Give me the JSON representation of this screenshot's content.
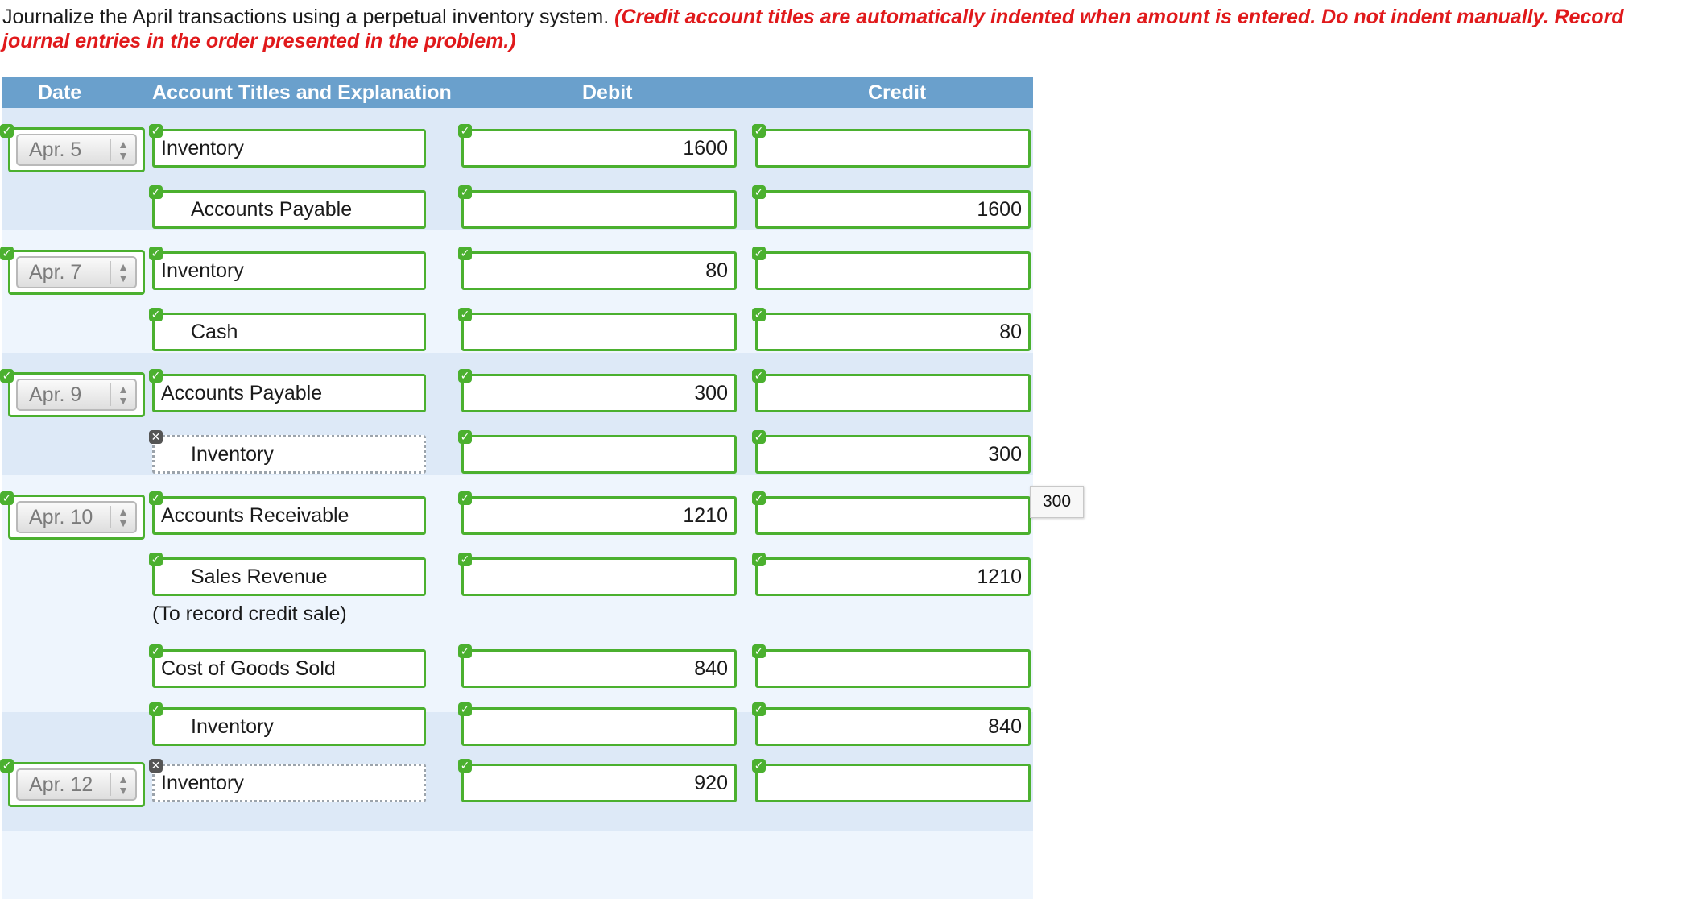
{
  "instructions": {
    "text": "Journalize the April transactions using a perpetual inventory system.",
    "note": "(Credit account titles are automatically indented when amount is entered. Do not indent manually. Record journal entries in the order presented in the problem.)"
  },
  "table": {
    "headers": {
      "date": "Date",
      "account": "Account Titles and Explanation",
      "debit": "Debit",
      "credit": "Credit"
    },
    "rows": [
      {
        "date": "Apr. 5",
        "account": "Inventory",
        "debit": "1600",
        "credit": "",
        "status": "correct"
      },
      {
        "date": "",
        "account": "Accounts Payable",
        "debit": "",
        "credit": "1600",
        "status": "correct"
      },
      {
        "date": "Apr. 7",
        "account": "Inventory",
        "debit": "80",
        "credit": "",
        "status": "correct"
      },
      {
        "date": "",
        "account": "Cash",
        "debit": "",
        "credit": "80",
        "status": "correct"
      },
      {
        "date": "Apr. 9",
        "account": "Accounts Payable",
        "debit": "300",
        "credit": "",
        "status": "correct"
      },
      {
        "date": "",
        "account": "Inventory",
        "debit": "",
        "credit": "300",
        "status": "incorrect"
      },
      {
        "date": "Apr. 10",
        "account": "Accounts Receivable",
        "debit": "1210",
        "credit": "",
        "status": "correct"
      },
      {
        "date": "",
        "account": "Sales Revenue",
        "debit": "",
        "credit": "1210",
        "status": "correct"
      },
      {
        "date": "",
        "account": "Cost of Goods Sold",
        "debit": "840",
        "credit": "",
        "status": "correct"
      },
      {
        "date": "",
        "account": "Inventory",
        "debit": "",
        "credit": "840",
        "status": "correct"
      },
      {
        "date": "Apr. 12",
        "account": "Inventory",
        "debit": "920",
        "credit": "",
        "status": "incorrect"
      }
    ],
    "explanation": "(To record credit sale)"
  },
  "tooltip": "300",
  "icons": {
    "correct": "check-icon",
    "incorrect": "x-icon",
    "select_arrows": "updown-arrows-icon"
  },
  "colors": {
    "header_bg": "#6aa0cc",
    "correct_border": "#4bb02f",
    "note_text": "#e0191b"
  }
}
